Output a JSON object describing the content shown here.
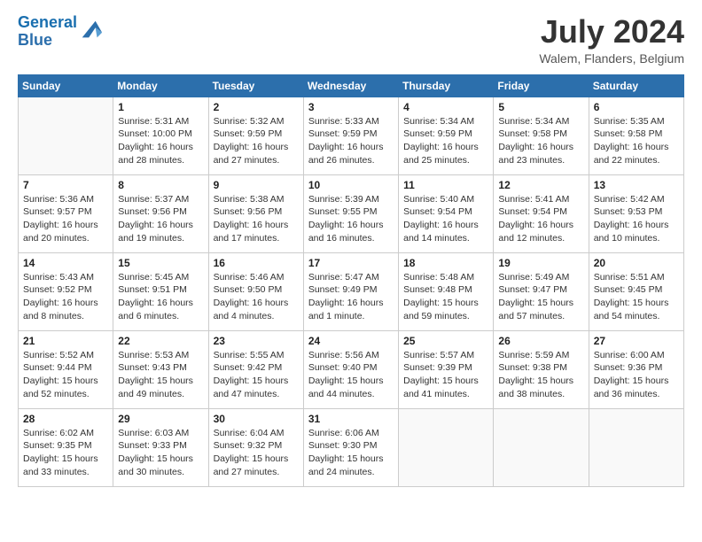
{
  "logo": {
    "line1": "General",
    "line2": "Blue"
  },
  "title": "July 2024",
  "location": "Walem, Flanders, Belgium",
  "days_of_week": [
    "Sunday",
    "Monday",
    "Tuesday",
    "Wednesday",
    "Thursday",
    "Friday",
    "Saturday"
  ],
  "weeks": [
    [
      {
        "day": "",
        "info": ""
      },
      {
        "day": "1",
        "info": "Sunrise: 5:31 AM\nSunset: 10:00 PM\nDaylight: 16 hours\nand 28 minutes."
      },
      {
        "day": "2",
        "info": "Sunrise: 5:32 AM\nSunset: 9:59 PM\nDaylight: 16 hours\nand 27 minutes."
      },
      {
        "day": "3",
        "info": "Sunrise: 5:33 AM\nSunset: 9:59 PM\nDaylight: 16 hours\nand 26 minutes."
      },
      {
        "day": "4",
        "info": "Sunrise: 5:34 AM\nSunset: 9:59 PM\nDaylight: 16 hours\nand 25 minutes."
      },
      {
        "day": "5",
        "info": "Sunrise: 5:34 AM\nSunset: 9:58 PM\nDaylight: 16 hours\nand 23 minutes."
      },
      {
        "day": "6",
        "info": "Sunrise: 5:35 AM\nSunset: 9:58 PM\nDaylight: 16 hours\nand 22 minutes."
      }
    ],
    [
      {
        "day": "7",
        "info": "Sunrise: 5:36 AM\nSunset: 9:57 PM\nDaylight: 16 hours\nand 20 minutes."
      },
      {
        "day": "8",
        "info": "Sunrise: 5:37 AM\nSunset: 9:56 PM\nDaylight: 16 hours\nand 19 minutes."
      },
      {
        "day": "9",
        "info": "Sunrise: 5:38 AM\nSunset: 9:56 PM\nDaylight: 16 hours\nand 17 minutes."
      },
      {
        "day": "10",
        "info": "Sunrise: 5:39 AM\nSunset: 9:55 PM\nDaylight: 16 hours\nand 16 minutes."
      },
      {
        "day": "11",
        "info": "Sunrise: 5:40 AM\nSunset: 9:54 PM\nDaylight: 16 hours\nand 14 minutes."
      },
      {
        "day": "12",
        "info": "Sunrise: 5:41 AM\nSunset: 9:54 PM\nDaylight: 16 hours\nand 12 minutes."
      },
      {
        "day": "13",
        "info": "Sunrise: 5:42 AM\nSunset: 9:53 PM\nDaylight: 16 hours\nand 10 minutes."
      }
    ],
    [
      {
        "day": "14",
        "info": "Sunrise: 5:43 AM\nSunset: 9:52 PM\nDaylight: 16 hours\nand 8 minutes."
      },
      {
        "day": "15",
        "info": "Sunrise: 5:45 AM\nSunset: 9:51 PM\nDaylight: 16 hours\nand 6 minutes."
      },
      {
        "day": "16",
        "info": "Sunrise: 5:46 AM\nSunset: 9:50 PM\nDaylight: 16 hours\nand 4 minutes."
      },
      {
        "day": "17",
        "info": "Sunrise: 5:47 AM\nSunset: 9:49 PM\nDaylight: 16 hours\nand 1 minute."
      },
      {
        "day": "18",
        "info": "Sunrise: 5:48 AM\nSunset: 9:48 PM\nDaylight: 15 hours\nand 59 minutes."
      },
      {
        "day": "19",
        "info": "Sunrise: 5:49 AM\nSunset: 9:47 PM\nDaylight: 15 hours\nand 57 minutes."
      },
      {
        "day": "20",
        "info": "Sunrise: 5:51 AM\nSunset: 9:45 PM\nDaylight: 15 hours\nand 54 minutes."
      }
    ],
    [
      {
        "day": "21",
        "info": "Sunrise: 5:52 AM\nSunset: 9:44 PM\nDaylight: 15 hours\nand 52 minutes."
      },
      {
        "day": "22",
        "info": "Sunrise: 5:53 AM\nSunset: 9:43 PM\nDaylight: 15 hours\nand 49 minutes."
      },
      {
        "day": "23",
        "info": "Sunrise: 5:55 AM\nSunset: 9:42 PM\nDaylight: 15 hours\nand 47 minutes."
      },
      {
        "day": "24",
        "info": "Sunrise: 5:56 AM\nSunset: 9:40 PM\nDaylight: 15 hours\nand 44 minutes."
      },
      {
        "day": "25",
        "info": "Sunrise: 5:57 AM\nSunset: 9:39 PM\nDaylight: 15 hours\nand 41 minutes."
      },
      {
        "day": "26",
        "info": "Sunrise: 5:59 AM\nSunset: 9:38 PM\nDaylight: 15 hours\nand 38 minutes."
      },
      {
        "day": "27",
        "info": "Sunrise: 6:00 AM\nSunset: 9:36 PM\nDaylight: 15 hours\nand 36 minutes."
      }
    ],
    [
      {
        "day": "28",
        "info": "Sunrise: 6:02 AM\nSunset: 9:35 PM\nDaylight: 15 hours\nand 33 minutes."
      },
      {
        "day": "29",
        "info": "Sunrise: 6:03 AM\nSunset: 9:33 PM\nDaylight: 15 hours\nand 30 minutes."
      },
      {
        "day": "30",
        "info": "Sunrise: 6:04 AM\nSunset: 9:32 PM\nDaylight: 15 hours\nand 27 minutes."
      },
      {
        "day": "31",
        "info": "Sunrise: 6:06 AM\nSunset: 9:30 PM\nDaylight: 15 hours\nand 24 minutes."
      },
      {
        "day": "",
        "info": ""
      },
      {
        "day": "",
        "info": ""
      },
      {
        "day": "",
        "info": ""
      }
    ]
  ]
}
